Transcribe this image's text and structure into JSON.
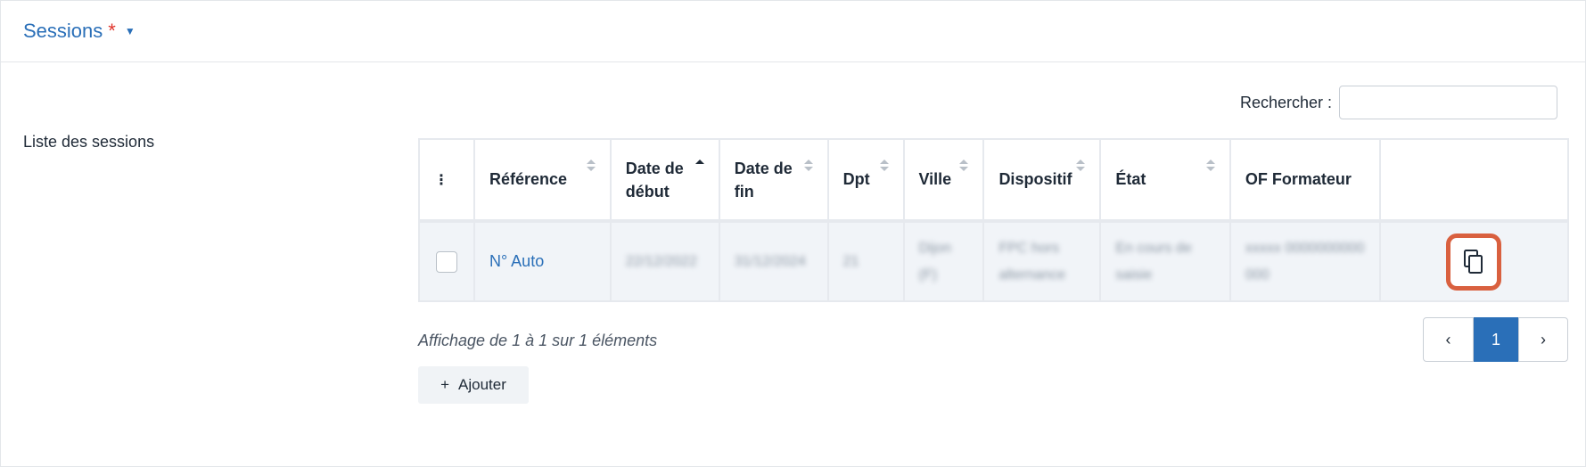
{
  "section": {
    "title": "Sessions",
    "required_mark": "*"
  },
  "list": {
    "label": "Liste des sessions"
  },
  "search": {
    "label": "Rechercher :",
    "value": ""
  },
  "table": {
    "headers": {
      "menu": "⋮",
      "reference": "Référence",
      "date_debut": "Date de début",
      "date_fin": "Date de fin",
      "dpt": "Dpt",
      "ville": "Ville",
      "dispositif": "Dispositif",
      "etat": "État",
      "of_formateur": "OF Formateur"
    },
    "rows": [
      {
        "reference": "N° Auto",
        "date_debut": "22/12/2022",
        "date_fin": "31/12/2024",
        "dpt": "21",
        "ville": "Dijon (F)",
        "dispositif": "FPC hors alternance",
        "etat": "En cours de saisie",
        "of_formateur": "xxxxx 0000000000000"
      }
    ]
  },
  "info": "Affichage de 1 à 1 sur 1 éléments",
  "pagination": {
    "prev": "‹",
    "current": "1",
    "next": "›"
  },
  "add_button": {
    "icon": "+",
    "label": "Ajouter"
  },
  "colors": {
    "accent": "#2a6fb8",
    "required": "#e0342b",
    "highlight": "#d9603f"
  }
}
